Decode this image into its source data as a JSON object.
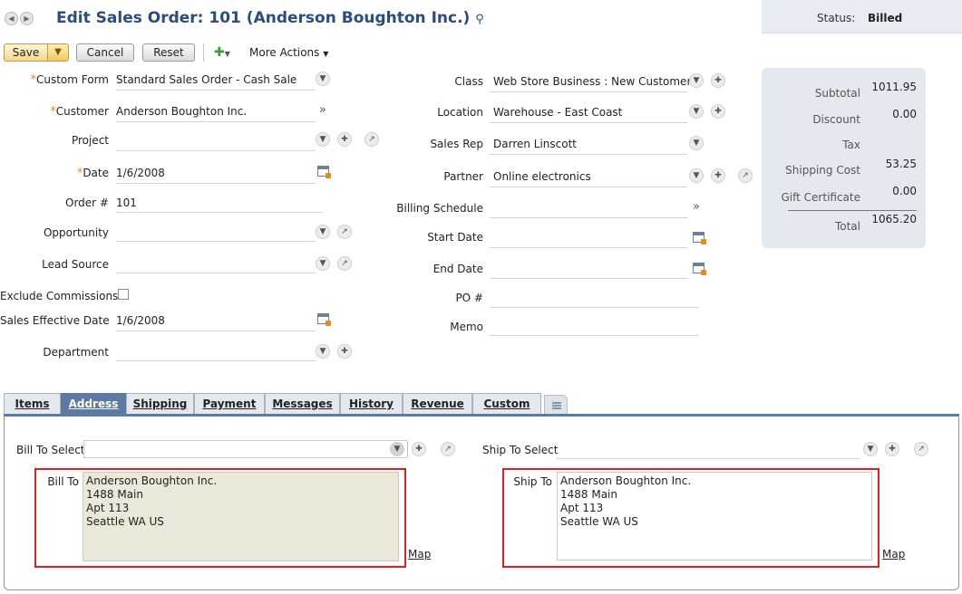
{
  "header": {
    "title": "Edit Sales Order: 101 (Anderson Boughton Inc.)",
    "status_label": "Status:",
    "status_value": "Billed"
  },
  "toolbar": {
    "save": "Save",
    "cancel": "Cancel",
    "reset": "Reset",
    "more_actions": "More Actions"
  },
  "left_fields": {
    "custom_form": {
      "label": "Custom Form",
      "value": "Standard Sales Order - Cash Sale"
    },
    "customer": {
      "label": "Customer",
      "value": "Anderson Boughton Inc."
    },
    "project": {
      "label": "Project",
      "value": ""
    },
    "date": {
      "label": "Date",
      "value": "1/6/2008"
    },
    "order_no": {
      "label": "Order #",
      "value": "101"
    },
    "opportunity": {
      "label": "Opportunity",
      "value": ""
    },
    "lead_source": {
      "label": "Lead Source",
      "value": ""
    },
    "exclude_commissions": {
      "label": "Exclude Commissions",
      "checked": false
    },
    "sales_effective_date": {
      "label": "Sales Effective Date",
      "value": "1/6/2008"
    },
    "department": {
      "label": "Department",
      "value": ""
    }
  },
  "mid_fields": {
    "class": {
      "label": "Class",
      "value": "Web Store Business : New Customer"
    },
    "location": {
      "label": "Location",
      "value": "Warehouse - East Coast"
    },
    "sales_rep": {
      "label": "Sales Rep",
      "value": "Darren Linscott"
    },
    "partner": {
      "label": "Partner",
      "value": "Online electronics"
    },
    "billing_schedule": {
      "label": "Billing Schedule",
      "value": ""
    },
    "start_date": {
      "label": "Start Date",
      "value": ""
    },
    "end_date": {
      "label": "End Date",
      "value": ""
    },
    "po_no": {
      "label": "PO #",
      "value": ""
    },
    "memo": {
      "label": "Memo",
      "value": ""
    }
  },
  "summary": {
    "subtotal": {
      "label": "Subtotal",
      "value": "1011.95"
    },
    "discount": {
      "label": "Discount",
      "value": "0.00"
    },
    "tax": {
      "label": "Tax",
      "value": ""
    },
    "shipping_cost": {
      "label": "Shipping Cost",
      "value": "53.25"
    },
    "gift_certificate": {
      "label": "Gift Certificate",
      "value": "0.00"
    },
    "total": {
      "label": "Total",
      "value": "1065.20"
    }
  },
  "tabs": [
    {
      "label": "Items"
    },
    {
      "label": "Address",
      "active": true
    },
    {
      "label": "Shipping"
    },
    {
      "label": "Payment"
    },
    {
      "label": "Messages"
    },
    {
      "label": "History"
    },
    {
      "label": "Revenue"
    },
    {
      "label": "Custom"
    }
  ],
  "address": {
    "bill_to_select_label": "Bill To Select",
    "bill_to_select_value": "",
    "ship_to_select_label": "Ship To Select",
    "ship_to_select_value": "",
    "bill_to_label": "Bill To",
    "bill_to_text": "Anderson Boughton Inc.\n1488 Main\nApt 113\nSeattle WA US",
    "ship_to_label": "Ship To",
    "ship_to_text": "Anderson Boughton Inc.\n1488 Main\nApt 113\nSeattle WA US",
    "map_link": "Map"
  },
  "colors": {
    "title": "#2b4c7e",
    "required_star": "#e98a15",
    "active_tab": "#5d7aa3",
    "highlight_box": "#e02020",
    "bill_to_bg": "#ebe8da"
  }
}
